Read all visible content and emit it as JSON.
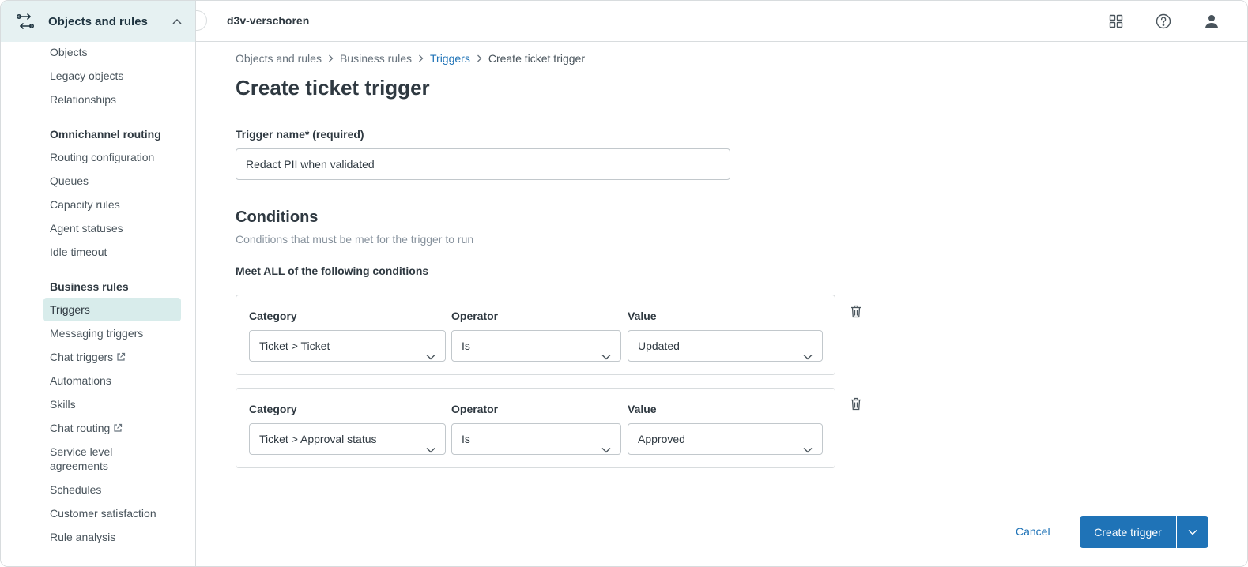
{
  "colors": {
    "accent": "#1f73b7",
    "sidebar_header_bg": "#e6f1f2",
    "active_item_bg": "#d8eceb"
  },
  "sidebar": {
    "title": "Objects and rules",
    "items": [
      {
        "label": "Objects"
      },
      {
        "label": "Legacy objects"
      },
      {
        "label": "Relationships"
      }
    ],
    "sections": [
      {
        "heading": "Omnichannel routing",
        "items": [
          {
            "label": "Routing configuration"
          },
          {
            "label": "Queues"
          },
          {
            "label": "Capacity rules"
          },
          {
            "label": "Agent statuses"
          },
          {
            "label": "Idle timeout"
          }
        ]
      },
      {
        "heading": "Business rules",
        "items": [
          {
            "label": "Triggers",
            "active": true
          },
          {
            "label": "Messaging triggers"
          },
          {
            "label": "Chat triggers",
            "external": true
          },
          {
            "label": "Automations"
          },
          {
            "label": "Skills"
          },
          {
            "label": "Chat routing",
            "external": true
          },
          {
            "label": "Service level agreements"
          },
          {
            "label": "Schedules"
          },
          {
            "label": "Customer satisfaction"
          },
          {
            "label": "Rule analysis"
          }
        ]
      }
    ]
  },
  "topbar": {
    "account_name": "d3v-verschoren",
    "icons": [
      "grid-icon",
      "help-icon",
      "user-icon"
    ]
  },
  "breadcrumb": [
    "Objects and rules",
    "Business rules",
    "Triggers",
    "Create ticket trigger"
  ],
  "page": {
    "title": "Create ticket trigger",
    "trigger_name_label": "Trigger name* (required)",
    "trigger_name_value": "Redact PII when validated",
    "conditions_title": "Conditions",
    "conditions_hint": "Conditions that must be met for the trigger to run",
    "meet_all_label": "Meet ALL of the following conditions"
  },
  "conditions": [
    {
      "category_label": "Category",
      "operator_label": "Operator",
      "value_label": "Value",
      "category": "Ticket > Ticket",
      "operator": "Is",
      "value": "Updated"
    },
    {
      "category_label": "Category",
      "operator_label": "Operator",
      "value_label": "Value",
      "category": "Ticket > Approval status",
      "operator": "Is",
      "value": "Approved"
    }
  ],
  "footer": {
    "cancel_label": "Cancel",
    "create_label": "Create trigger"
  }
}
